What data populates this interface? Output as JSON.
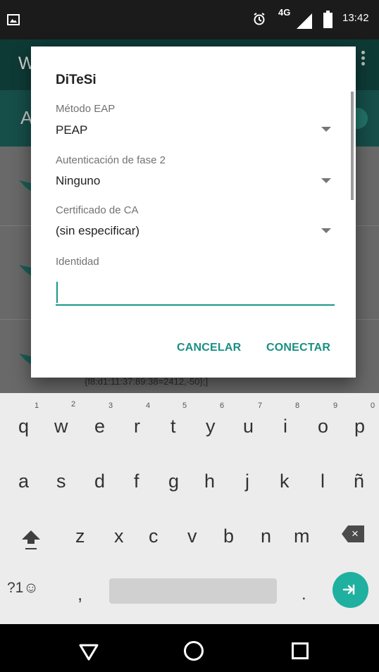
{
  "status": {
    "network": "4G",
    "time": "13:42"
  },
  "background": {
    "app_title_partial": "W",
    "subtitle_partial": "A",
    "detail": "{f8:d1:11:37:89:38=2412,-50};]"
  },
  "dialog": {
    "title": "DiTeSi",
    "fields": [
      {
        "label": "Método EAP",
        "value": "PEAP"
      },
      {
        "label": "Autenticación de fase 2",
        "value": "Ninguno"
      },
      {
        "label": "Certificado de CA",
        "value": "(sin especificar)"
      }
    ],
    "identity_label": "Identidad",
    "identity_value": "",
    "cancel_label": "CANCELAR",
    "connect_label": "CONECTAR"
  },
  "keyboard": {
    "row1": [
      "q",
      "w",
      "e",
      "r",
      "t",
      "y",
      "u",
      "i",
      "o",
      "p"
    ],
    "row1_nums": [
      "1",
      "2",
      "3",
      "4",
      "5",
      "6",
      "7",
      "8",
      "9",
      "0"
    ],
    "row2": [
      "a",
      "s",
      "d",
      "f",
      "g",
      "h",
      "j",
      "k",
      "l",
      "ñ"
    ],
    "row3": [
      "z",
      "x",
      "c",
      "v",
      "b",
      "n",
      "m"
    ],
    "symbols_key": "?1☺",
    "comma": ",",
    "period": "."
  },
  "icons": {
    "status": [
      "image-icon",
      "alarm-icon",
      "signal-icon",
      "battery-icon"
    ],
    "keyboard": [
      "shift-icon",
      "backspace-icon",
      "next-icon"
    ],
    "navigation": [
      "back-icon",
      "home-icon",
      "recent-apps-icon"
    ]
  },
  "colors": {
    "accent": "#198f83",
    "next_button": "#1fb09f",
    "background_app_bar": "#0e3a36"
  }
}
